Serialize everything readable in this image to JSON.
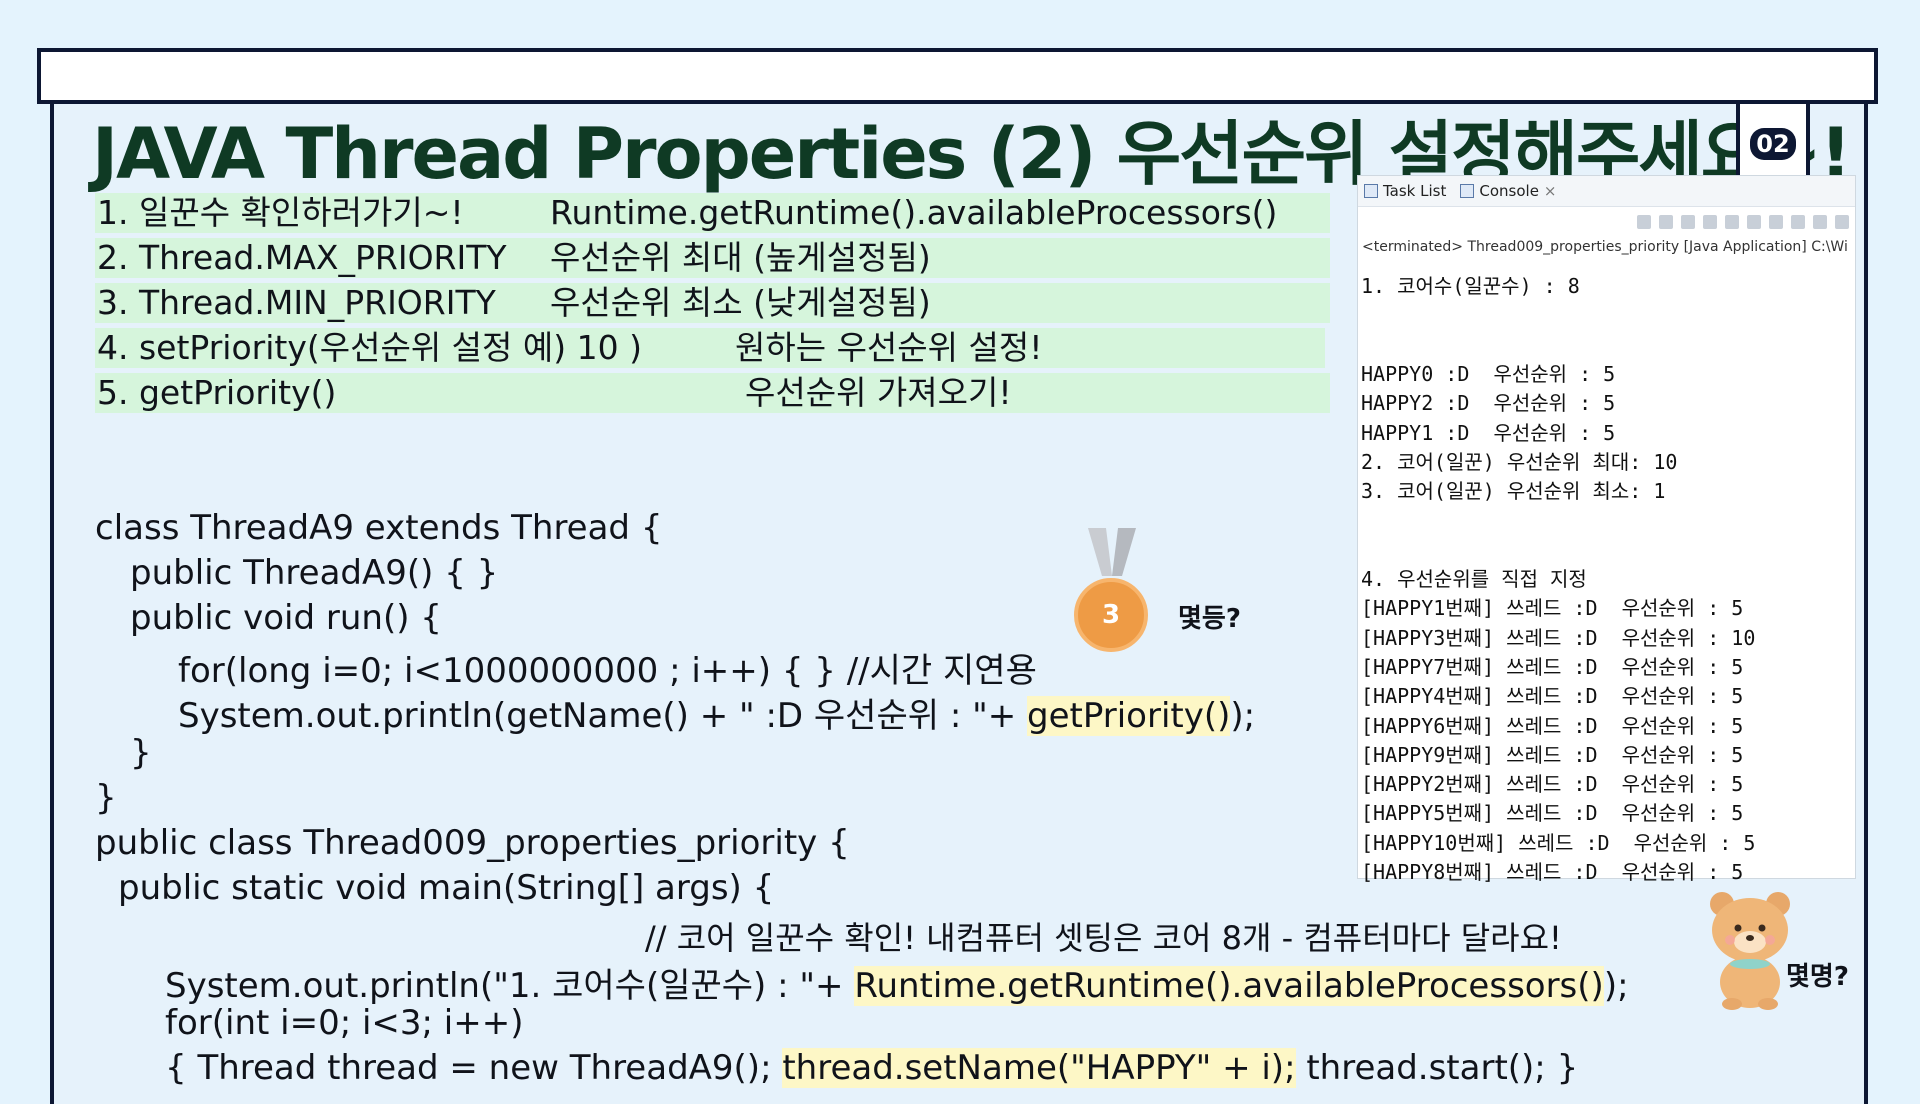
{
  "title": "JAVA Thread Properties (2) 우선순위 설정해주세요~!",
  "badge": "02",
  "list": [
    {
      "a": "1. 일꾼수 확인하러가기~!",
      "b": "Runtime.getRuntime().availableProcessors()"
    },
    {
      "a": "2. Thread.MAX_PRIORITY",
      "b": "우선순위 최대 (높게설정됨)"
    },
    {
      "a": "3. Thread.MIN_PRIORITY",
      "b": "우선순위 최소 (낮게설정됨)"
    },
    {
      "a": "4. setPriority(우선순위 설정  예) 10 )",
      "b": "원하는 우선순위 설정!"
    },
    {
      "a": "5. getPriority()",
      "b": "우선순위 가져오기!"
    }
  ],
  "code": {
    "l1": "class ThreadA9 extends Thread {",
    "l2": "public ThreadA9() { }",
    "l3": "public void run() {",
    "l4": "for(long i=0; i<1000000000 ; i++) { } //시간 지연용",
    "l5a": "System.out.println(getName() + \" :D 우선순위 : \"+ ",
    "l5b": "getPriority()",
    "l5c": ");",
    "l6": "}",
    "l7": "}",
    "l8": "public class Thread009_properties_priority {",
    "l9": "public static void main(String[] args) {",
    "l10": "// 코어 일꾼수 확인! 내컴퓨터 셋팅은 코어 8개 - 컴퓨터마다 달라요!",
    "l11a": "System.out.println(\"1. 코어수(일꾼수) : \"+ ",
    "l11b": "Runtime.getRuntime().availableProcessors()",
    "l11c": ");",
    "l12": "for(int i=0; i<3; i++)",
    "l13a": "{ Thread thread = new ThreadA9(); ",
    "l13b": "thread.setName(\"HAPPY\" + i);",
    "l13c": " thread.start(); }"
  },
  "console": {
    "tab1": "Task List",
    "tab2": "Console",
    "tab2_close": "×",
    "terminated": "<terminated> Thread009_properties_priority [Java Application] C:\\Wi",
    "lines": [
      "1. 코어수(일꾼수) : 8",
      "",
      "",
      "HAPPY0 :D  우선순위 : 5",
      "HAPPY2 :D  우선순위 : 5",
      "HAPPY1 :D  우선순위 : 5",
      "2. 코어(일꾼) 우선순위 최대: 10",
      "3. 코어(일꾼) 우선순위 최소: 1",
      "",
      "",
      "4. 우선순위를 직접 지정",
      "[HAPPY1번째] 쓰레드 :D  우선순위 : 5",
      "[HAPPY3번째] 쓰레드 :D  우선순위 : 10",
      "[HAPPY7번째] 쓰레드 :D  우선순위 : 5",
      "[HAPPY4번째] 쓰레드 :D  우선순위 : 5",
      "[HAPPY6번째] 쓰레드 :D  우선순위 : 5",
      "[HAPPY9번째] 쓰레드 :D  우선순위 : 5",
      "[HAPPY2번째] 쓰레드 :D  우선순위 : 5",
      "[HAPPY5번째] 쓰레드 :D  우선순위 : 5",
      "[HAPPY10번째] 쓰레드 :D  우선순위 : 5",
      "[HAPPY8번째] 쓰레드 :D  우선순위 : 5"
    ]
  },
  "medal_number": "3",
  "question1": "몇등?",
  "question2": "몇명?"
}
